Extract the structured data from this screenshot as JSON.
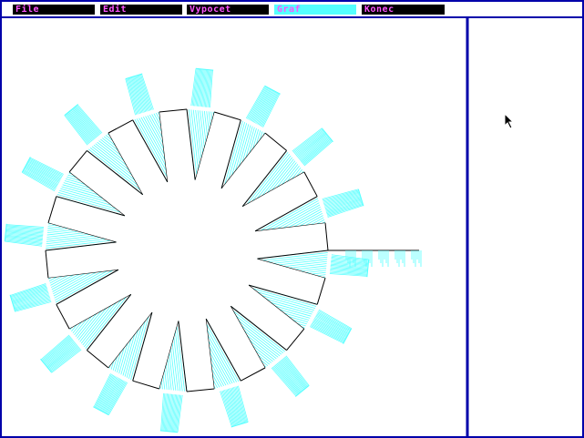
{
  "menu": {
    "items": [
      {
        "id": "file",
        "label": "File",
        "active": false
      },
      {
        "id": "edit",
        "label": "Edit",
        "active": false
      },
      {
        "id": "vypocet",
        "label": "Vypocet",
        "active": false
      },
      {
        "id": "graf",
        "label": "Graf",
        "active": true
      },
      {
        "id": "konec",
        "label": "Konec",
        "active": false
      }
    ]
  },
  "colors": {
    "frame": "#0000aa",
    "menu_bg": "#000000",
    "menu_text": "#ff55ff",
    "menu_active_bg": "#55ffff",
    "hatch": "#55ffff",
    "outline": "#000000"
  },
  "graph": {
    "teeth_count": 16,
    "shape": "gear-cross-section with hatched loads"
  },
  "cursor": "arrow-pointer-icon"
}
